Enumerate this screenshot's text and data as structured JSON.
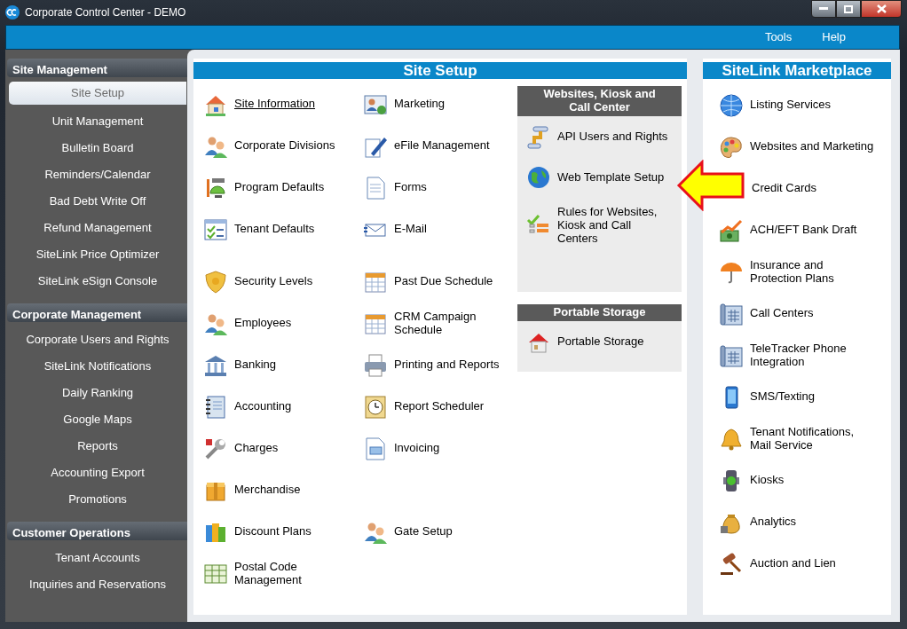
{
  "window": {
    "title": "Corporate Control Center - DEMO"
  },
  "menu": [
    {
      "label": "Tools"
    },
    {
      "label": "Help"
    }
  ],
  "sidebar": {
    "sections": [
      {
        "title": "Site Management",
        "items": [
          {
            "label": "Site Setup",
            "selected": true
          },
          {
            "label": "Unit Management",
            "selected": false
          },
          {
            "label": "Bulletin Board",
            "selected": false
          },
          {
            "label": "Reminders/Calendar",
            "selected": false
          },
          {
            "label": "Bad Debt Write Off",
            "selected": false
          },
          {
            "label": "Refund Management",
            "selected": false
          },
          {
            "label": "SiteLink Price Optimizer",
            "selected": false
          },
          {
            "label": "SiteLink eSign Console",
            "selected": false
          }
        ]
      },
      {
        "title": "Corporate Management",
        "items": [
          {
            "label": "Corporate Users and Rights",
            "selected": false
          },
          {
            "label": "SiteLink Notifications",
            "selected": false
          },
          {
            "label": "Daily Ranking",
            "selected": false
          },
          {
            "label": "Google Maps",
            "selected": false
          },
          {
            "label": "Reports",
            "selected": false
          },
          {
            "label": "Accounting Export",
            "selected": false
          },
          {
            "label": "Promotions",
            "selected": false
          }
        ]
      },
      {
        "title": "Customer Operations",
        "items": [
          {
            "label": "Tenant Accounts",
            "selected": false
          },
          {
            "label": "Inquiries and Reservations",
            "selected": false
          }
        ]
      }
    ]
  },
  "site_setup": {
    "title": "Site Setup",
    "groups": [
      {
        "rows": [
          {
            "column_1": {
              "label": "Site Information",
              "hovered": true
            },
            "column_2": {
              "label": "Marketing",
              "hovered": false
            }
          },
          {
            "column_1": {
              "label": "Corporate Divisions",
              "hovered": false
            },
            "column_2": {
              "label": "eFile Management",
              "hovered": false
            }
          },
          {
            "column_1": {
              "label": "Program Defaults",
              "hovered": false
            },
            "column_2": {
              "label": "Forms",
              "hovered": false
            }
          },
          {
            "column_1": {
              "label": "Tenant Defaults",
              "hovered": false
            },
            "column_2": {
              "label": "E-Mail",
              "hovered": false
            }
          }
        ]
      },
      {
        "rows": [
          {
            "column_1": {
              "label": "Security Levels",
              "hovered": false
            },
            "column_2": {
              "label": "Past Due Schedule",
              "hovered": false
            }
          },
          {
            "column_1": {
              "label": "Employees",
              "hovered": false
            },
            "column_2": {
              "label": "CRM Campaign\nSchedule",
              "hovered": false
            }
          },
          {
            "column_1": {
              "label": "Banking",
              "hovered": false
            },
            "column_2": {
              "label": "Printing and Reports",
              "hovered": false
            }
          },
          {
            "column_1": {
              "label": "Accounting",
              "hovered": false
            },
            "column_2": {
              "label": "Report Scheduler",
              "hovered": false
            }
          },
          {
            "column_1": {
              "label": "Charges",
              "hovered": false
            },
            "column_2": {
              "label": "Invoicing",
              "hovered": false
            }
          },
          {
            "column_1": {
              "label": "Merchandise",
              "hovered": false
            }
          },
          {
            "column_1": {
              "label": "Discount Plans",
              "hovered": false
            },
            "column_2": {
              "label": "Gate Setup",
              "hovered": false
            }
          },
          {
            "column_1": {
              "label": "Postal Code\nManagement",
              "hovered": false
            }
          }
        ]
      }
    ]
  },
  "websites_box": {
    "title": "Websites, Kiosk and\nCall Center",
    "items": [
      {
        "label": "API Users and Rights"
      },
      {
        "label": "Web Template Setup"
      },
      {
        "label": "Rules for Websites,\nKiosk and Call\nCenters"
      }
    ]
  },
  "portable_box": {
    "title": "Portable Storage",
    "items": [
      {
        "label": "Portable Storage"
      }
    ]
  },
  "marketplace": {
    "title": "SiteLink Marketplace",
    "items": [
      {
        "label": "Listing Services"
      },
      {
        "label": "Websites and Marketing"
      },
      {
        "label": "Credit Cards"
      },
      {
        "label": "ACH/EFT Bank Draft"
      },
      {
        "label": "Insurance and\nProtection Plans"
      },
      {
        "label": "Call Centers"
      },
      {
        "label": "TeleTracker Phone\nIntegration"
      },
      {
        "label": "SMS/Texting"
      },
      {
        "label": "Tenant Notifications,\nMail Service"
      },
      {
        "label": "Kiosks"
      },
      {
        "label": "Analytics"
      },
      {
        "label": "Auction and Lien"
      }
    ]
  }
}
